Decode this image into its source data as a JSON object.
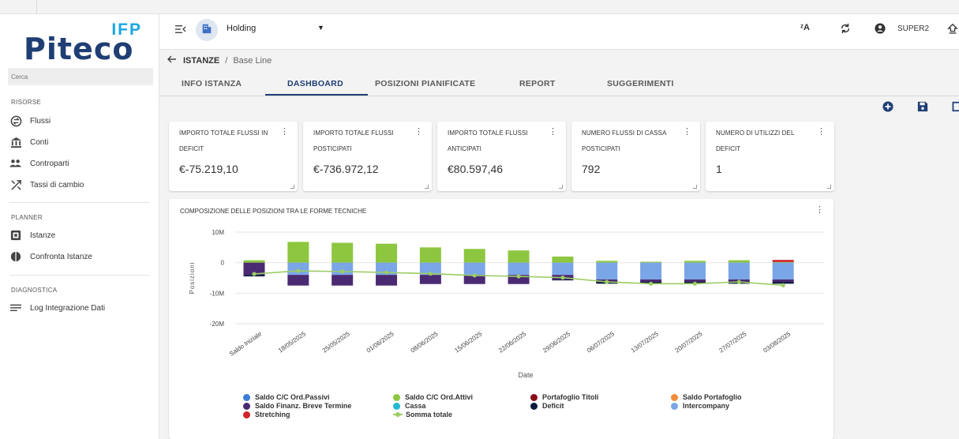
{
  "app": {
    "logo_ifp": "IFP",
    "logo_main": "Piteco",
    "search_placeholder": "Cerca"
  },
  "sidebar": {
    "sections": [
      {
        "title": "RISORSE",
        "items": [
          {
            "label": "Flussi",
            "icon": "flows-icon"
          },
          {
            "label": "Conti",
            "icon": "bank-icon"
          },
          {
            "label": "Controparti",
            "icon": "people-icon"
          },
          {
            "label": "Tassi di cambio",
            "icon": "exchange-icon"
          }
        ]
      },
      {
        "title": "PLANNER",
        "items": [
          {
            "label": "Istanze",
            "icon": "instance-icon"
          },
          {
            "label": "Confronta Istanze",
            "icon": "compare-icon"
          }
        ]
      },
      {
        "title": "DIAGNOSTICA",
        "items": [
          {
            "label": "Log Integrazione Dati",
            "icon": "list-icon"
          }
        ]
      }
    ]
  },
  "header": {
    "entity": "Holding",
    "user": "SUPER2"
  },
  "breadcrumb": {
    "root": "ISTANZE",
    "separator": "/",
    "current": "Base Line"
  },
  "tabs": [
    {
      "label": "INFO ISTANZA",
      "active": false
    },
    {
      "label": "DASHBOARD",
      "active": true
    },
    {
      "label": "POSIZIONI PIANIFICATE",
      "active": false
    },
    {
      "label": "REPORT",
      "active": false
    },
    {
      "label": "SUGGERIMENTI",
      "active": false
    }
  ],
  "cards": [
    {
      "line1": "IMPORTO TOTALE FLUSSI IN",
      "line2": "DEFICIT",
      "value": "€-75.219,10"
    },
    {
      "line1": "IMPORTO TOTALE FLUSSI",
      "line2": "POSTICIPATI",
      "value": "€-736.972,12"
    },
    {
      "line1": "IMPORTO TOTALE FLUSSI",
      "line2": "ANTICIPATI",
      "value": "€80.597,46"
    },
    {
      "line1": "NUMERO FLUSSI DI CASSA",
      "line2": "POSTICIPATI",
      "value": "792"
    },
    {
      "line1": "NUMERO DI UTILIZZI DEL",
      "line2": "DEFICIT",
      "value": "1"
    }
  ],
  "colors": {
    "primary": "#1f3e74",
    "attivi": "#8dc63f",
    "passivi": "#3a7ed8",
    "intercompany": "#7aa6e8",
    "breve_termine": "#4a2a72",
    "deficit": "#0d1b3e",
    "titoli": "#8b0a1a",
    "portafoglio": "#f28c38",
    "stretching": "#d0232a",
    "cassa": "#22b8cf",
    "somma": "#9ccc65"
  },
  "chart_data": {
    "type": "bar",
    "title": "COMPOSIZIONE DELLE POSIZIONI TRA LE FORME TECNICHE",
    "xlabel": "Date",
    "ylabel": "Posizioni",
    "ylim": [
      -20,
      10
    ],
    "y_ticks": [
      "10M",
      "0",
      "-10M",
      "-20M"
    ],
    "y_tick_values": [
      10,
      0,
      -10,
      -20
    ],
    "categories": [
      "Saldo Iniziale",
      "18/05/2025",
      "25/05/2025",
      "01/06/2025",
      "08/06/2025",
      "15/06/2025",
      "22/06/2025",
      "29/06/2025",
      "06/07/2025",
      "13/07/2025",
      "20/07/2025",
      "27/07/2025",
      "03/08/2025"
    ],
    "series": [
      {
        "name": "Saldo C/C Ord.Attivi",
        "values": [
          0.8,
          6.8,
          6.5,
          6.2,
          5.0,
          4.5,
          4.0,
          2.0,
          0.6,
          0.3,
          0.6,
          0.8,
          0.2
        ]
      },
      {
        "name": "Portafoglio Titoli",
        "values": [
          0,
          0,
          0,
          0,
          0,
          0,
          0,
          0,
          0,
          0,
          0,
          0,
          0
        ]
      },
      {
        "name": "Stretching",
        "values": [
          0,
          0,
          0,
          0,
          0,
          0,
          0,
          0,
          0,
          0,
          0,
          0,
          0.7
        ]
      },
      {
        "name": "Intercompany",
        "values": [
          0,
          -4.0,
          -4.0,
          -4.0,
          -4.0,
          -4.0,
          -4.0,
          -4.0,
          -5.5,
          -5.5,
          -5.5,
          -5.5,
          -5.5
        ]
      },
      {
        "name": "Saldo Finanz. Breve Termine",
        "values": [
          -4.0,
          -3.5,
          -3.5,
          -3.5,
          -3.0,
          -3.0,
          -3.0,
          -1.5,
          -0.8,
          -0.8,
          -0.8,
          -0.8,
          -0.8
        ]
      },
      {
        "name": "Deficit",
        "values": [
          -0.5,
          0,
          0,
          0,
          0,
          0,
          0,
          -0.3,
          -0.6,
          -0.6,
          -0.6,
          -0.6,
          -0.6
        ]
      },
      {
        "name": "Saldo C/C Ord.Passivi",
        "values": [
          0,
          0,
          0,
          0,
          0,
          0,
          0,
          0,
          0,
          0,
          0,
          0,
          0
        ]
      },
      {
        "name": "Cassa",
        "values": [
          0,
          0,
          0,
          0,
          0,
          0,
          0,
          0,
          0,
          0,
          0,
          0,
          0
        ]
      },
      {
        "name": "Saldo Portafoglio",
        "values": [
          0,
          0,
          0,
          0,
          0,
          0,
          0,
          0,
          0,
          0,
          0,
          0,
          0
        ]
      }
    ],
    "line_series": {
      "name": "Somma totale",
      "values": [
        -3.7,
        -2.7,
        -2.9,
        -3.2,
        -3.6,
        -4.2,
        -4.5,
        -4.9,
        -6.3,
        -6.9,
        -6.9,
        -6.3,
        -7.4
      ]
    },
    "legend": [
      {
        "label": "Saldo C/C Ord.Passivi",
        "color": "#3a7ed8",
        "kind": "dot"
      },
      {
        "label": "Saldo C/C Ord.Attivi",
        "color": "#8dc63f",
        "kind": "dot"
      },
      {
        "label": "Portafoglio Titoli",
        "color": "#8b0a1a",
        "kind": "dot"
      },
      {
        "label": "Saldo Portafoglio",
        "color": "#f28c38",
        "kind": "dot"
      },
      {
        "label": "Saldo Finanz. Breve Termine",
        "color": "#4a2a72",
        "kind": "dot"
      },
      {
        "label": "Cassa",
        "color": "#22b8cf",
        "kind": "dot"
      },
      {
        "label": "Deficit",
        "color": "#0d1b3e",
        "kind": "dot"
      },
      {
        "label": "Intercompany",
        "color": "#7aa6e8",
        "kind": "dot"
      },
      {
        "label": "Stretching",
        "color": "#d0232a",
        "kind": "dot"
      },
      {
        "label": "Somma totale",
        "color": "#9ccc65",
        "kind": "line"
      }
    ],
    "legend_position": "bottom"
  }
}
